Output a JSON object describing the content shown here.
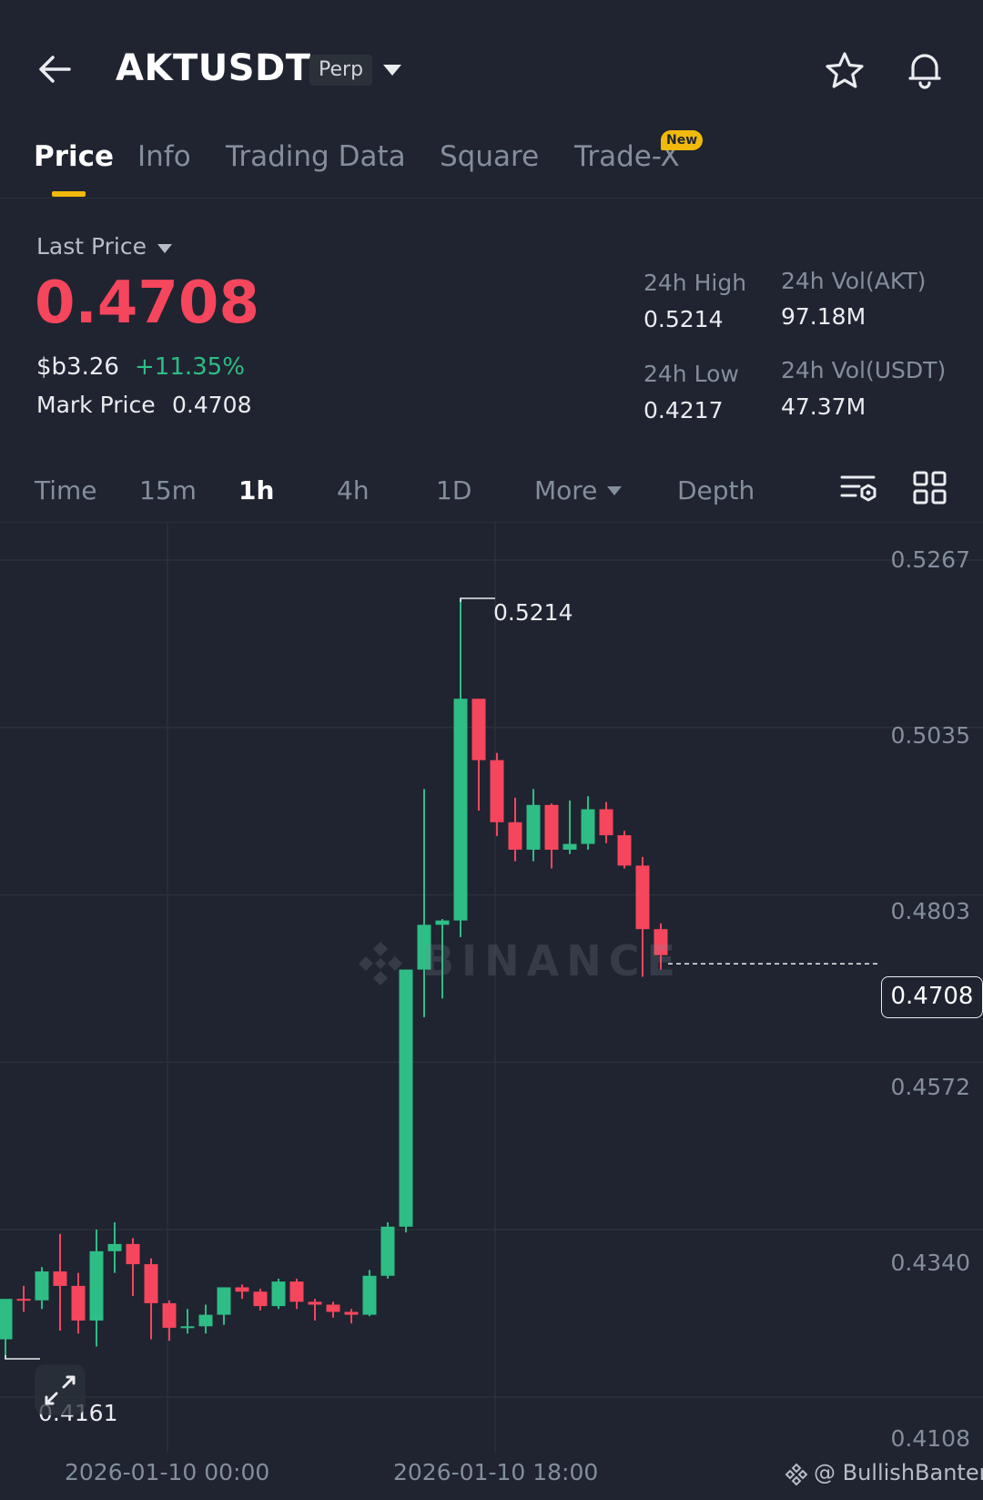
{
  "header": {
    "symbol": "AKTUSDT",
    "contract_type": "Perp",
    "icons": {
      "back": "arrow-left-icon",
      "caret": "caret-down-icon",
      "favorite": "star-icon",
      "alert": "bell-icon"
    }
  },
  "tabs": [
    {
      "label": "Price",
      "active": true
    },
    {
      "label": "Info",
      "active": false
    },
    {
      "label": "Trading Data",
      "active": false
    },
    {
      "label": "Square",
      "active": false
    },
    {
      "label": "Trade-X",
      "active": false,
      "badge": "New"
    }
  ],
  "ticker": {
    "last_price_label": "Last Price",
    "last_price": "0.4708",
    "fiat_price": "$b3.26",
    "change_pct": "+11.35%",
    "mark_price_label": "Mark Price",
    "mark_price": "0.4708"
  },
  "stats": {
    "high_label": "24h High",
    "high": "0.5214",
    "low_label": "24h Low",
    "low": "0.4217",
    "vol_base_label": "24h Vol(AKT)",
    "vol_base": "97.18M",
    "vol_quote_label": "24h Vol(USDT)",
    "vol_quote": "47.37M"
  },
  "intervals": [
    {
      "label": "Time",
      "active": false
    },
    {
      "label": "15m",
      "active": false
    },
    {
      "label": "1h",
      "active": true
    },
    {
      "label": "4h",
      "active": false
    },
    {
      "label": "1D",
      "active": false
    },
    {
      "label": "More",
      "active": false
    },
    {
      "label": "Depth",
      "active": false
    }
  ],
  "chart_data": {
    "type": "candlestick",
    "interval": "1h",
    "y_ticks": [
      "0.5267",
      "0.5035",
      "0.4803",
      "0.4572",
      "0.4340",
      "0.4108"
    ],
    "ylim": [
      0.4108,
      0.5267
    ],
    "x_ticks": [
      "2026-01-10 00:00",
      "2026-01-10 18:00"
    ],
    "high_marker": "0.5214",
    "low_marker": "0.4161",
    "current_price": "0.4708",
    "watermark": "BINANCE",
    "colors": {
      "up": "#2ebd85",
      "down": "#f6465d",
      "grid": "#2b3139"
    },
    "candles": [
      {
        "o": 0.4188,
        "h": 0.424,
        "l": 0.4161,
        "c": 0.4244
      },
      {
        "o": 0.4244,
        "h": 0.4262,
        "l": 0.4226,
        "c": 0.4242
      },
      {
        "o": 0.4242,
        "h": 0.4288,
        "l": 0.423,
        "c": 0.4282
      },
      {
        "o": 0.4282,
        "h": 0.4334,
        "l": 0.42,
        "c": 0.4262
      },
      {
        "o": 0.4262,
        "h": 0.428,
        "l": 0.4196,
        "c": 0.4214
      },
      {
        "o": 0.4214,
        "h": 0.434,
        "l": 0.4178,
        "c": 0.431
      },
      {
        "o": 0.431,
        "h": 0.435,
        "l": 0.428,
        "c": 0.432
      },
      {
        "o": 0.432,
        "h": 0.4328,
        "l": 0.4248,
        "c": 0.4292
      },
      {
        "o": 0.4292,
        "h": 0.43,
        "l": 0.4188,
        "c": 0.4238
      },
      {
        "o": 0.4238,
        "h": 0.4242,
        "l": 0.4186,
        "c": 0.4204
      },
      {
        "o": 0.4204,
        "h": 0.423,
        "l": 0.4196,
        "c": 0.4206
      },
      {
        "o": 0.4206,
        "h": 0.4236,
        "l": 0.4196,
        "c": 0.4222
      },
      {
        "o": 0.4222,
        "h": 0.426,
        "l": 0.4208,
        "c": 0.426
      },
      {
        "o": 0.426,
        "h": 0.4264,
        "l": 0.4244,
        "c": 0.4254
      },
      {
        "o": 0.4254,
        "h": 0.4258,
        "l": 0.4228,
        "c": 0.4234
      },
      {
        "o": 0.4234,
        "h": 0.4272,
        "l": 0.423,
        "c": 0.4268
      },
      {
        "o": 0.4268,
        "h": 0.4272,
        "l": 0.423,
        "c": 0.424
      },
      {
        "o": 0.424,
        "h": 0.4244,
        "l": 0.4214,
        "c": 0.4236
      },
      {
        "o": 0.4236,
        "h": 0.424,
        "l": 0.4218,
        "c": 0.4226
      },
      {
        "o": 0.4226,
        "h": 0.423,
        "l": 0.421,
        "c": 0.4222
      },
      {
        "o": 0.4222,
        "h": 0.4284,
        "l": 0.422,
        "c": 0.4276
      },
      {
        "o": 0.4276,
        "h": 0.435,
        "l": 0.4272,
        "c": 0.4344
      },
      {
        "o": 0.4344,
        "h": 0.47,
        "l": 0.4336,
        "c": 0.47
      },
      {
        "o": 0.47,
        "h": 0.495,
        "l": 0.4634,
        "c": 0.4762
      },
      {
        "o": 0.4762,
        "h": 0.477,
        "l": 0.466,
        "c": 0.4768
      },
      {
        "o": 0.4768,
        "h": 0.5214,
        "l": 0.4745,
        "c": 0.5075
      },
      {
        "o": 0.5075,
        "h": 0.5075,
        "l": 0.492,
        "c": 0.499
      },
      {
        "o": 0.499,
        "h": 0.5,
        "l": 0.4885,
        "c": 0.4904
      },
      {
        "o": 0.4904,
        "h": 0.4938,
        "l": 0.485,
        "c": 0.4866
      },
      {
        "o": 0.4866,
        "h": 0.495,
        "l": 0.485,
        "c": 0.4928
      },
      {
        "o": 0.4928,
        "h": 0.493,
        "l": 0.484,
        "c": 0.4866
      },
      {
        "o": 0.4866,
        "h": 0.4934,
        "l": 0.486,
        "c": 0.4874
      },
      {
        "o": 0.4874,
        "h": 0.494,
        "l": 0.4866,
        "c": 0.4922
      },
      {
        "o": 0.4922,
        "h": 0.4932,
        "l": 0.4875,
        "c": 0.4886
      },
      {
        "o": 0.4886,
        "h": 0.4892,
        "l": 0.484,
        "c": 0.4844
      },
      {
        "o": 0.4844,
        "h": 0.4856,
        "l": 0.469,
        "c": 0.4756
      },
      {
        "o": 0.4756,
        "h": 0.4764,
        "l": 0.47,
        "c": 0.472
      }
    ]
  },
  "toolbar_icons": {
    "indicators": "indicator-settings-icon",
    "layout": "grid-layout-icon",
    "fullscreen": "expand-icon"
  },
  "footer": {
    "credit": "@ BullishBanter"
  }
}
